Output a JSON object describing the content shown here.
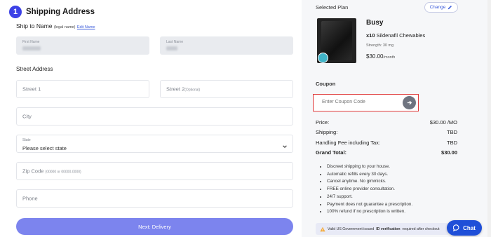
{
  "shipping": {
    "step_number": "1",
    "title": "Shipping Address",
    "ship_to_label": "Ship to Name",
    "legal_note": "(legal name)",
    "edit_link": "Edit Name",
    "first_name_label": "First Name",
    "last_name_label": "Last Name",
    "street_heading": "Street Address",
    "street1_placeholder": "Street 1",
    "street2_placeholder": "Street 2",
    "street2_optional": "(Optional)",
    "city_placeholder": "City",
    "state_label": "State",
    "state_value": "Please select state",
    "zip_placeholder": "Zip Code",
    "zip_hint": "(00000 or 00000-0000)",
    "phone_placeholder": "Phone",
    "next_button": "Next: Delivery"
  },
  "plan": {
    "heading": "Selected Plan",
    "change_label": "Change",
    "name": "Busy",
    "quantity": "x10",
    "product": "Sildenafil Chewables",
    "strength": "Strength: 30 mg",
    "price": "$30.00",
    "period": "/month"
  },
  "coupon": {
    "label": "Coupon",
    "placeholder": "Enter Coupon Code"
  },
  "summary": {
    "price_label": "Price:",
    "price_value": "$30.00 /MO",
    "shipping_label": "Shipping:",
    "shipping_value": "TBD",
    "handling_label": "Handling Fee including Tax:",
    "handling_value": "TBD",
    "total_label": "Grand Total:",
    "total_value": "$30.00"
  },
  "perks": [
    "Discreet shipping to your house.",
    "Automatic refills every 30 days.",
    "Cancel anytime. No gimmicks.",
    "FREE online provider consultation.",
    "24/7 support.",
    "Payment does not guarantee a prescription.",
    "100% refund if no prescription is written."
  ],
  "notice": {
    "prefix": "Valid US Government issued",
    "bold": "ID verification",
    "suffix": "required after checkout"
  },
  "chat": {
    "label": "Chat"
  },
  "colors": {
    "accent": "#3c41e6",
    "button": "#7c84ee",
    "coupon_highlight": "#e03a3a",
    "chat": "#1f4fd8"
  }
}
